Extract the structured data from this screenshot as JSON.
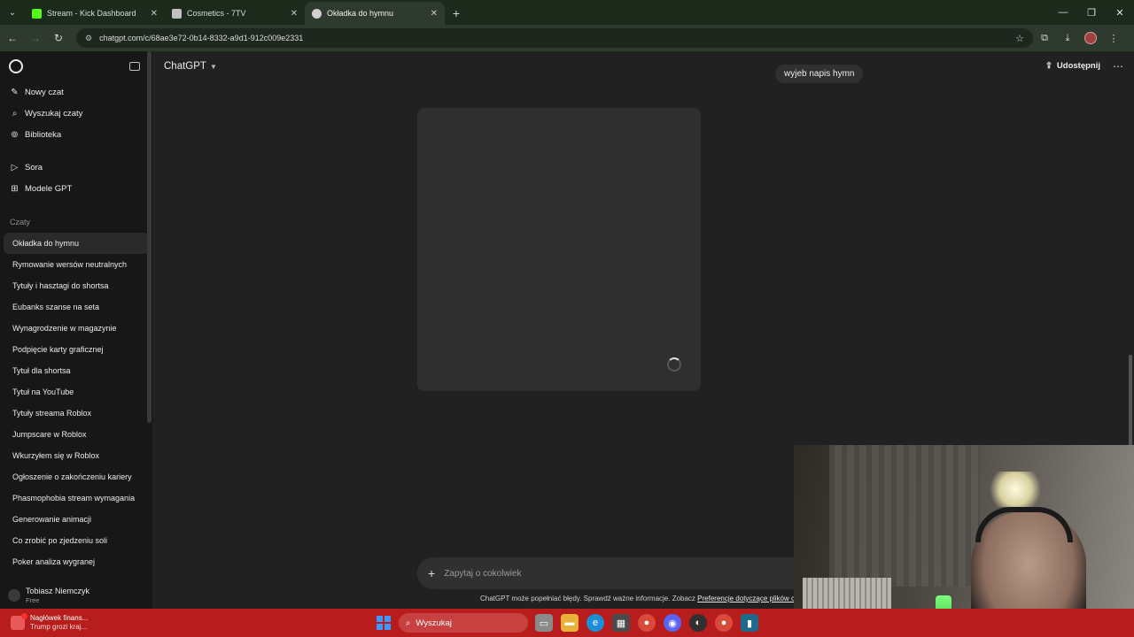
{
  "browser": {
    "tabs": [
      {
        "title": "Stream - Kick Dashboard",
        "fav_color": "#53fc18",
        "active": false
      },
      {
        "title": "Cosmetics - 7TV",
        "fav_color": "#c0c0c0",
        "active": false
      },
      {
        "title": "Okładka do hymnu",
        "fav_color": "#d0d0d0",
        "active": true
      }
    ],
    "url": "chatgpt.com/c/68ae3e72-0b14-8332-a9d1-912c009e2331"
  },
  "sidebar": {
    "top_items": [
      {
        "label": "Nowy czat",
        "icon": "edit-icon"
      },
      {
        "label": "Wyszukaj czaty",
        "icon": "search-icon"
      },
      {
        "label": "Biblioteka",
        "icon": "library-icon"
      }
    ],
    "mid_items": [
      {
        "label": "Sora",
        "icon": "play-icon"
      },
      {
        "label": "Modele GPT",
        "icon": "grid-icon"
      }
    ],
    "section_label": "Czaty",
    "chats": [
      "Okładka do hymnu",
      "Rymowanie wersów neutralnych",
      "Tytuły i hasztagi do shortsa",
      "Eubanks szanse na seta",
      "Wynagrodzenie w magazynie",
      "Podpięcie karty graficznej",
      "Tytuł dla shortsa",
      "Tytuł na YouTube",
      "Tytuły streama Roblox",
      "Jumpscare w Roblox",
      "Wkurzyłem się w Roblox",
      "Ogłoszenie o zakończeniu kariery",
      "Phasmophobia stream wymagania",
      "Generowanie animacji",
      "Co zrobić po zjedzeniu soli",
      "Poker analiza wygranej"
    ],
    "user": {
      "name": "Tobiasz Niemczyk",
      "plan": "Free"
    }
  },
  "main": {
    "model": "ChatGPT",
    "share_label": "Udostępnij",
    "user_message": "wyjeb napis hymn",
    "composer_placeholder": "Zapytaj o cokolwiek",
    "disclaimer": "ChatGPT może popełniać błędy. Sprawdź ważne informacje. Zobacz",
    "disclaimer_link": "Preferencje dotyczące plików cookie"
  },
  "taskbar": {
    "news_title": "Nagłówek finans...",
    "news_sub": "Trump grozi kraj...",
    "search_label": "Wyszukaj"
  }
}
